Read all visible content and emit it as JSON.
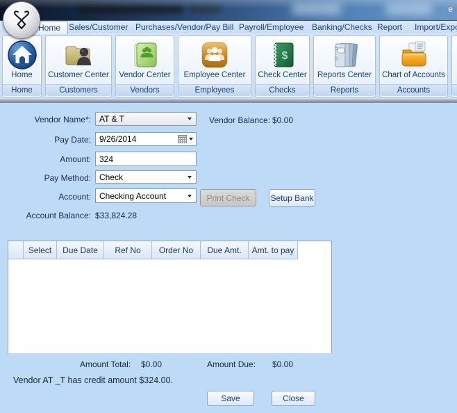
{
  "colors": {
    "accent": "#15428b",
    "main_bg": "#bddaf7",
    "titlebar_dark": "#0a1424",
    "grid_header_bg": "#d9e7f8"
  },
  "window": {
    "title_fragment": "e"
  },
  "tabs": {
    "active": "Home",
    "items": [
      {
        "label": "Home"
      },
      {
        "label": "Sales/Customer"
      },
      {
        "label": "Purchases/Vendor/Pay Bill"
      },
      {
        "label": "Payroll/Employee"
      },
      {
        "label": "Banking/Checks"
      },
      {
        "label": "Report"
      },
      {
        "label": "Import/Expo"
      }
    ]
  },
  "ribbon": {
    "groups": [
      {
        "label": "Home",
        "caption": "Home",
        "icon": "home-icon"
      },
      {
        "label": "Customer Center",
        "caption": "Customers",
        "icon": "customer-folder-icon"
      },
      {
        "label": "Vendor Center",
        "caption": "Vendors",
        "icon": "vendor-book-icon"
      },
      {
        "label": "Employee Center",
        "caption": "Employees",
        "icon": "employee-people-icon"
      },
      {
        "label": "Check Center",
        "caption": "Checks",
        "icon": "checkbook-icon"
      },
      {
        "label": "Reports Center",
        "caption": "Reports",
        "icon": "reports-books-icon"
      },
      {
        "label": "Chart of Accounts",
        "caption": "Accounts",
        "icon": "accounts-folder-icon"
      }
    ]
  },
  "form": {
    "vendor_name": {
      "label": "Vendor Name*:",
      "value": "AT & T"
    },
    "vendor_balance": {
      "label": "Vendor Balance:",
      "value": "$0.00"
    },
    "pay_date": {
      "label": "Pay Date:",
      "value": "9/26/2014"
    },
    "amount": {
      "label": "Amount:",
      "value": "324"
    },
    "pay_method": {
      "label": "Pay Method:",
      "value": "Check"
    },
    "account": {
      "label": "Account:",
      "value": "Checking Account"
    },
    "print_check_label": "Print Check",
    "setup_bank_label": "Setup Bank",
    "account_balance": {
      "label": "Account Balance:",
      "value": "$33,824.28"
    }
  },
  "grid": {
    "headers": [
      "",
      "Select",
      "Due Date",
      "Ref No",
      "Order No",
      "Due Amt.",
      "Amt. to pay"
    ],
    "rows": []
  },
  "totals": {
    "amount_total_label": "Amount Total:",
    "amount_total": "$0.00",
    "amount_due_label": "Amount Due:",
    "amount_due": "$0.00"
  },
  "credit_note": "Vendor AT _T has credit amount $324.00.",
  "actions": {
    "save": "Save",
    "close": "Close"
  }
}
